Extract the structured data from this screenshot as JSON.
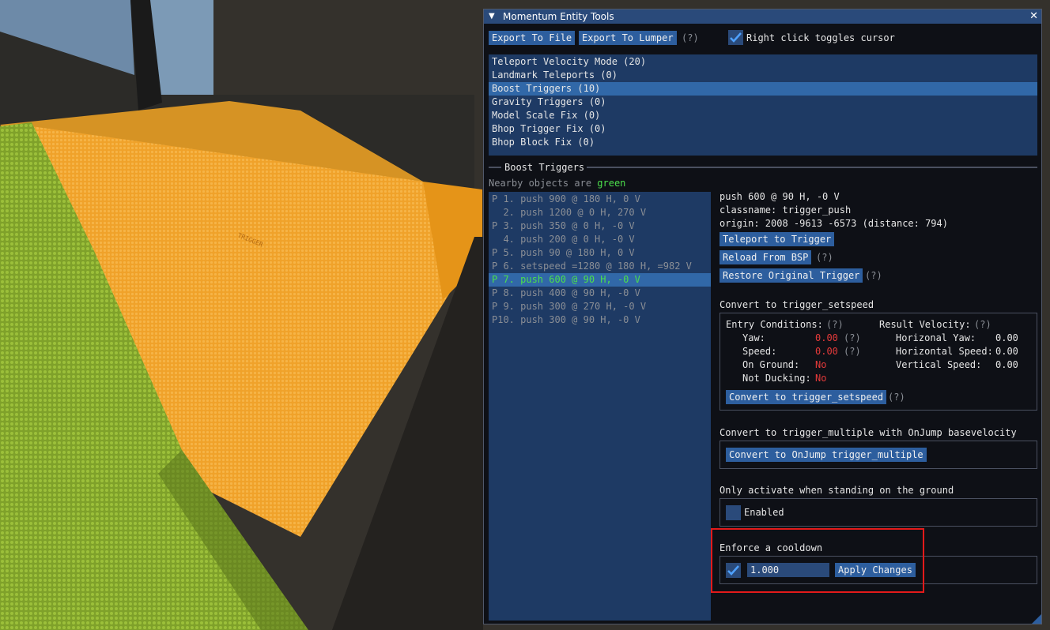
{
  "window": {
    "title": "Momentum Entity Tools"
  },
  "toolbar": {
    "export_file_label": "Export To File",
    "export_lumper_label": "Export To Lumper",
    "help_marker": "(?)",
    "right_click_label": "Right click toggles cursor",
    "right_click_checked": true
  },
  "categories": [
    {
      "label": "Teleport Velocity Mode (20)",
      "selected": false
    },
    {
      "label": "Landmark Teleports (0)",
      "selected": false
    },
    {
      "label": "Boost Triggers (10)",
      "selected": true
    },
    {
      "label": "Gravity Triggers (0)",
      "selected": false
    },
    {
      "label": "Model Scale Fix (0)",
      "selected": false
    },
    {
      "label": "Bhop Trigger Fix (0)",
      "selected": false
    },
    {
      "label": "Bhop Block Fix (0)",
      "selected": false
    }
  ],
  "section": {
    "title": "Boost Triggers",
    "nearby_prefix": "Nearby objects are",
    "nearby_color_word": "green"
  },
  "entities": [
    {
      "label": "P 1. push 900 @ 180 H, 0 V",
      "selected": false
    },
    {
      "label": "  2. push 1200 @ 0 H, 270 V",
      "selected": false
    },
    {
      "label": "P 3. push 350 @ 0 H, -0 V",
      "selected": false
    },
    {
      "label": "  4. push 200 @ 0 H, -0 V",
      "selected": false
    },
    {
      "label": "P 5. push 90 @ 180 H, 0 V",
      "selected": false
    },
    {
      "label": "P 6. setspeed =1280 @ 180 H, =982 V",
      "selected": false
    },
    {
      "label": "P 7. push 600 @ 90 H, -0 V",
      "selected": true
    },
    {
      "label": "P 8. push 400 @ 90 H, -0 V",
      "selected": false
    },
    {
      "label": "P 9. push 300 @ 270 H, -0 V",
      "selected": false
    },
    {
      "label": "P10. push 300 @ 90 H, -0 V",
      "selected": false
    }
  ],
  "details": {
    "line1": "push 600 @ 90 H, -0 V",
    "line2": "classname: trigger_push",
    "line3": "origin: 2008 -9613 -6573 (distance: 794)",
    "teleport_label": "Teleport to Trigger",
    "reload_label": "Reload From BSP",
    "restore_label": "Restore Original Trigger"
  },
  "setspeed": {
    "heading": "Convert to trigger_setspeed",
    "entry_conditions_label": "Entry Conditions:",
    "result_velocity_label": "Result Velocity:",
    "yaw_label": "Yaw:",
    "yaw_value": "0.00",
    "speed_label": "Speed:",
    "speed_value": "0.00",
    "on_ground_label": "On Ground:",
    "on_ground_value": "No",
    "not_ducking_label": "Not Ducking:",
    "not_ducking_value": "No",
    "hyaw_label": "Horizonal Yaw:",
    "hyaw_value": "0.00",
    "hspeed_label": "Horizontal Speed:",
    "hspeed_value": "0.00",
    "vspeed_label": "Vertical Speed:",
    "vspeed_value": "0.00",
    "convert_label": "Convert to trigger_setspeed"
  },
  "multiple": {
    "heading": "Convert to trigger_multiple with OnJump basevelocity",
    "convert_label": "Convert to OnJump trigger_multiple"
  },
  "ground": {
    "heading": "Only activate when standing on the ground",
    "enabled_label": "Enabled",
    "enabled_checked": false
  },
  "cooldown": {
    "heading": "Enforce a cooldown",
    "checked": true,
    "value": "1.000",
    "apply_label": "Apply Changes"
  },
  "scene_texture_word": "TRIGGER",
  "colors": {
    "accent": "#2d5e9e",
    "selection": "#3168a8",
    "list_bg": "#1e3a64",
    "highlight_red": "#e43a3a",
    "nearby_green": "#4ce04c",
    "trigger_orange": "#f5a623"
  }
}
